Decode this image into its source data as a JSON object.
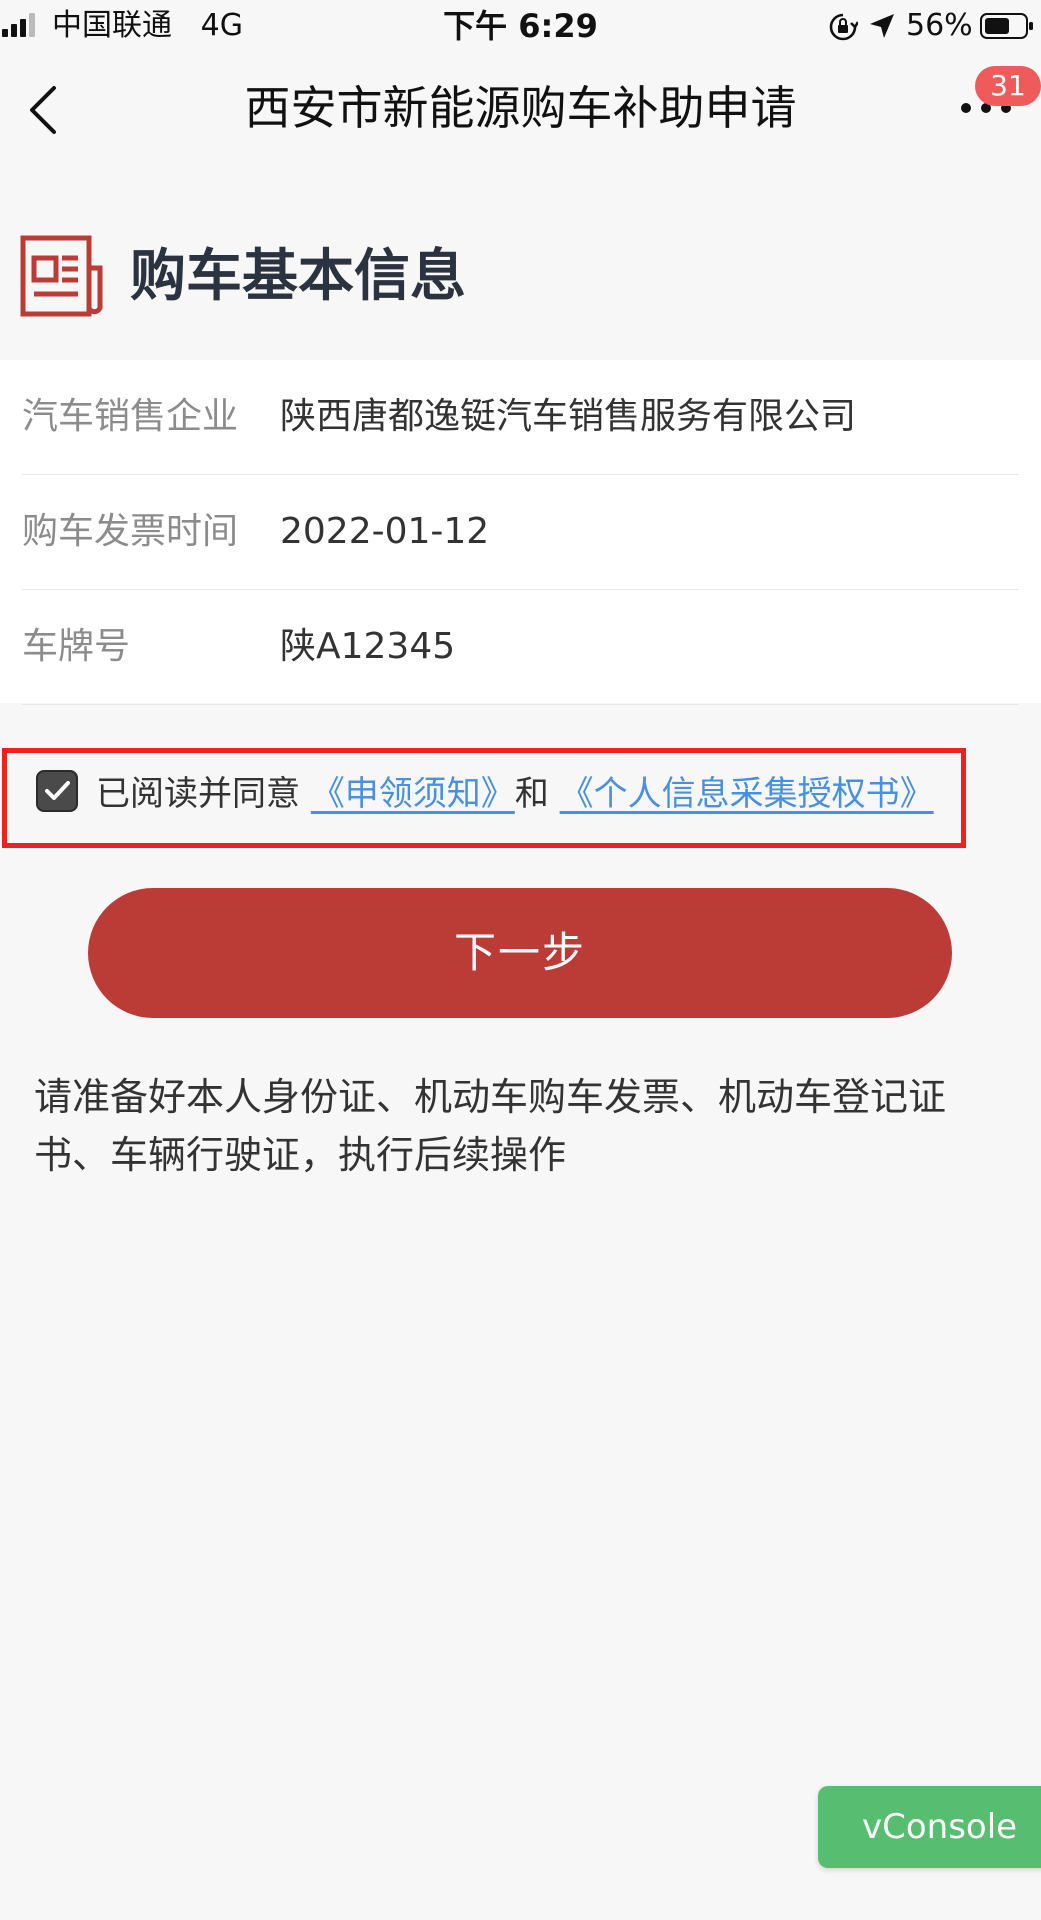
{
  "status_bar": {
    "carrier": "中国联通",
    "network": "4G",
    "time": "下午 6:29",
    "battery_percent": "56%"
  },
  "nav": {
    "title": "西安市新能源购车补助申请",
    "badge_count": "31"
  },
  "section": {
    "title": "购车基本信息",
    "icon": "document-icon"
  },
  "info_rows": [
    {
      "label": "汽车销售企业",
      "value": "陕西唐都逸铤汽车销售服务有限公司"
    },
    {
      "label": "购车发票时间",
      "value": "2022-01-12"
    },
    {
      "label": "车牌号",
      "value": "陕A12345"
    }
  ],
  "agreement": {
    "checked": true,
    "prefix": "已阅读并同意",
    "link1": "《申领须知》",
    "connector": "和",
    "link2": "《个人信息采集授权书》"
  },
  "next_button": {
    "label": "下一步"
  },
  "notice": {
    "text": "请准备好本人身份证、机动车购车发票、机动车登记证书、车辆行驶证，执行后续操作"
  },
  "vconsole": {
    "label": "vConsole"
  },
  "colors": {
    "background": "#f7f7f7",
    "primary_red": "#bb3c36",
    "link_blue": "#4a90e2",
    "highlight_red": "#f0201c",
    "vconsole_green": "#56bd71",
    "badge_red": "#ef5a5a"
  }
}
